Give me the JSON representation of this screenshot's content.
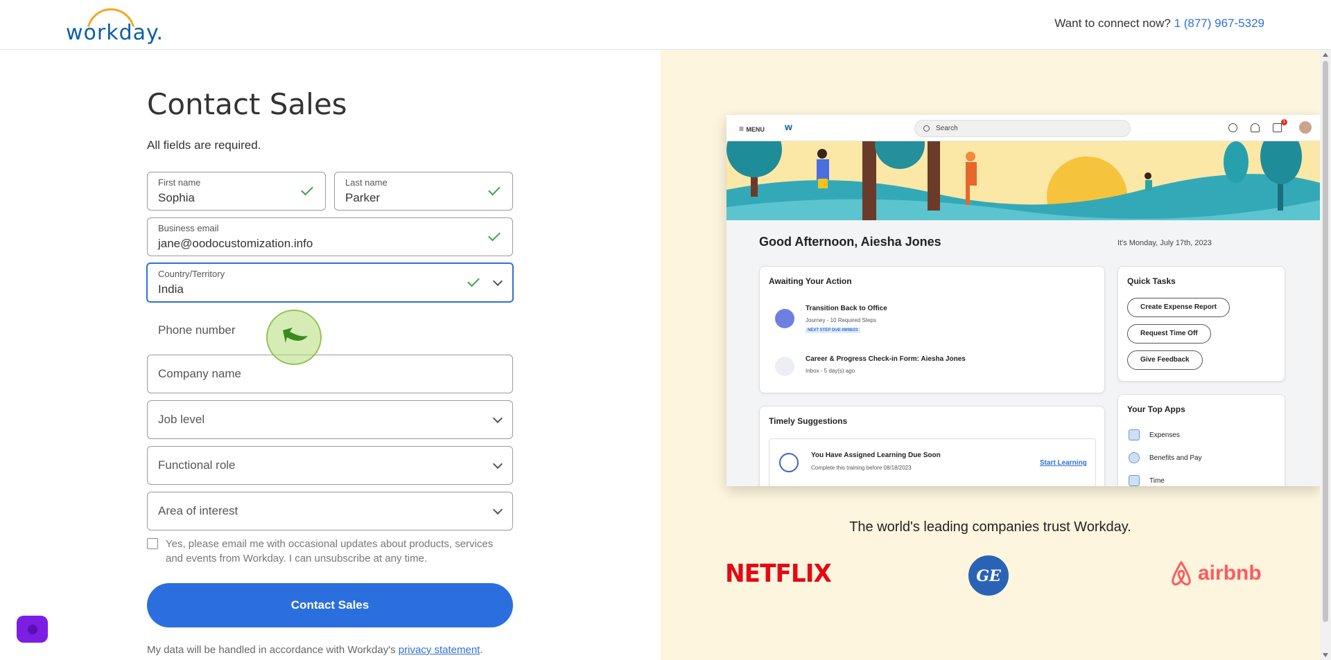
{
  "header": {
    "logo_text": "workday.",
    "connect_text": "Want to connect now?",
    "phone": "1 (877) 967-5329"
  },
  "form": {
    "title": "Contact Sales",
    "required_note": "All fields are required.",
    "first_name": {
      "label": "First name",
      "value": "Sophia"
    },
    "last_name": {
      "label": "Last name",
      "value": "Parker"
    },
    "email": {
      "label": "Business email",
      "value": "jane@oodocustomization.info"
    },
    "country": {
      "label": "Country/Territory",
      "value": "India"
    },
    "phone_label": "Phone number",
    "company_placeholder": "Company name",
    "job_level": "Job level",
    "functional_role": "Functional role",
    "area_of_interest": "Area of interest",
    "consent_text": "Yes, please email me with occasional updates about products, services and events from Workday. I can unsubscribe at any time.",
    "submit_label": "Contact Sales",
    "privacy_prefix": "My data will be handled in accordance with Workday's",
    "privacy_link": "privacy statement",
    "privacy_suffix": "."
  },
  "mockup": {
    "menu_label": "MENU",
    "logo_letter": "w",
    "search_placeholder": "Search",
    "badge_count": "1",
    "greeting": "Good Afternoon, Aiesha Jones",
    "date": "It's Monday, July 17th, 2023",
    "awaiting": {
      "title": "Awaiting Your Action",
      "items": [
        {
          "title": "Transition Back to Office",
          "sub": "Journey - 10 Required Steps",
          "tag": "NEXT STEP DUE 09/08/23"
        },
        {
          "title": "Career & Progress Check-in Form: Aiesha Jones",
          "sub": "Inbox - 5 day(s) ago"
        }
      ]
    },
    "quick_tasks": {
      "title": "Quick Tasks",
      "items": [
        "Create Expense Report",
        "Request Time Off",
        "Give Feedback"
      ]
    },
    "timely": {
      "title": "Timely Suggestions",
      "item_title": "You Have Assigned Learning Due Soon",
      "item_sub": "Complete this training before 08/18/2023",
      "action": "Start Learning"
    },
    "top_apps": {
      "title": "Your Top Apps",
      "items": [
        "Expenses",
        "Benefits and Pay",
        "Time"
      ]
    }
  },
  "trust": {
    "headline": "The world's leading companies trust Workday.",
    "logos": [
      "NETFLIX",
      "GE",
      "airbnb"
    ]
  },
  "colors": {
    "accent": "#2b6fde",
    "panel_bg": "#fdf5dd",
    "valid": "#3fa34d"
  }
}
